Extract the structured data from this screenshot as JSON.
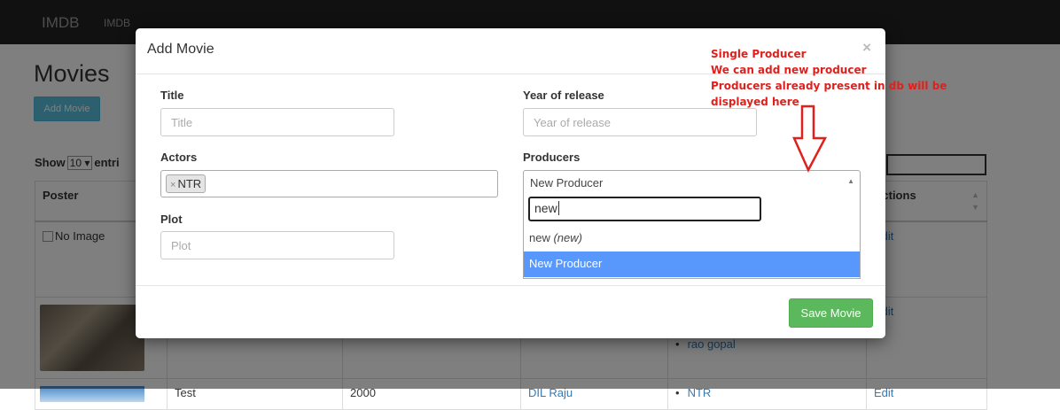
{
  "navbar": {
    "brand": "IMDB",
    "link": "IMDB"
  },
  "page": {
    "title": "Movies",
    "add_button": "Add Movie"
  },
  "table_controls": {
    "show_label": "Show",
    "entries_value": "10 ▾",
    "entries_label": "entri"
  },
  "table": {
    "headers": {
      "poster": "Poster",
      "actions": "Actions"
    },
    "rows": [
      {
        "poster_text": "No Image",
        "name": "",
        "year": "",
        "producer": "",
        "actor": "",
        "action": "Edit"
      },
      {
        "poster_text": "",
        "name": "",
        "year": "",
        "producer": "",
        "actor": "rao gopal",
        "action": "Edit"
      },
      {
        "poster_text": "",
        "name": "Test",
        "year": "2000",
        "producer": "DIL Raju",
        "actor": "NTR",
        "action": "Edit"
      }
    ]
  },
  "modal": {
    "title": "Add Movie",
    "close": "×",
    "title_label": "Title",
    "title_placeholder": "Title",
    "year_label": "Year of release",
    "year_placeholder": "Year of release",
    "actors_label": "Actors",
    "actor_tag": "NTR",
    "tag_remove": "×",
    "producers_label": "Producers",
    "producers_selected": "New Producer",
    "select_arrow": "▲",
    "plot_label": "Plot",
    "plot_placeholder": "Plot",
    "dropdown": {
      "search_value": "new",
      "options": [
        {
          "label": "new",
          "suffix": " (new)"
        },
        {
          "label": "New Producer"
        }
      ]
    },
    "save_button": "Save Movie"
  },
  "annotation": {
    "lines": [
      "Single Producer",
      "We can add new producer",
      "Producers already present in db will be",
      "displayed here"
    ],
    "color": "#e0201c"
  }
}
